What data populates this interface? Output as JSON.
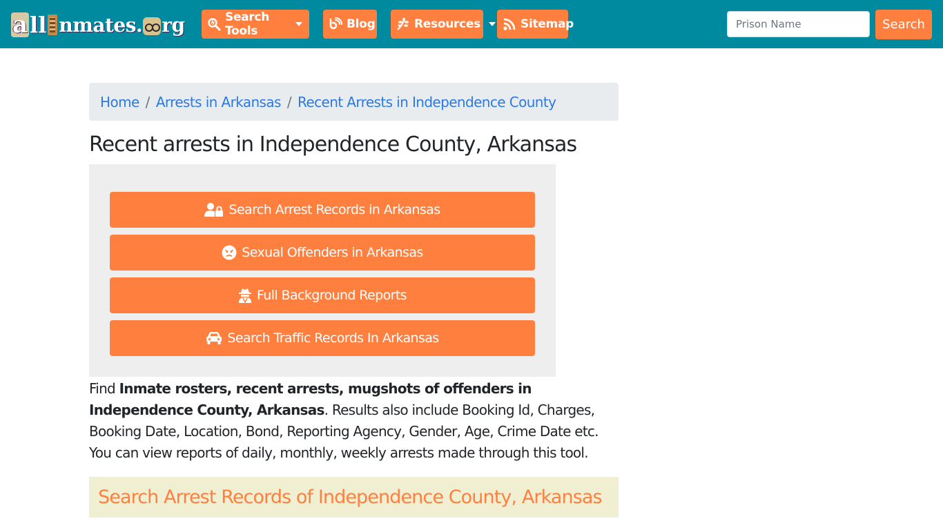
{
  "site": {
    "logo_text": "allInmates.org",
    "logo_parts": {
      "a": "a",
      "ll": "ll",
      "rest": "nmates.",
      "end": "rg"
    }
  },
  "nav": {
    "items": [
      {
        "label": "Search Tools",
        "icon": "search-icon",
        "has_dropdown": true
      },
      {
        "label": "Blog",
        "icon": "blog-icon",
        "has_dropdown": false
      },
      {
        "label": "Resources",
        "icon": "leaf-icon",
        "has_dropdown": true
      },
      {
        "label": "Sitemap",
        "icon": "rss-icon",
        "has_dropdown": false
      }
    ],
    "search": {
      "placeholder": "Prison Name",
      "value": "",
      "button_label": "Search"
    }
  },
  "breadcrumb": {
    "items": [
      {
        "label": "Home"
      },
      {
        "label": "Arrests in Arkansas"
      },
      {
        "label": "Recent Arrests in Independence County"
      }
    ],
    "separator": "/"
  },
  "page": {
    "title": "Recent arrests in Independence County, Arkansas"
  },
  "actions": [
    {
      "label": "Search Arrest Records in Arkansas",
      "icon": "user-lock-icon"
    },
    {
      "label": "Sexual Offenders in Arkansas",
      "icon": "angry-face-icon"
    },
    {
      "label": "Full Background Reports",
      "icon": "user-secret-icon"
    },
    {
      "label": "Search Traffic Records In Arkansas",
      "icon": "car-icon"
    }
  ],
  "intro": {
    "prefix": "Find ",
    "bold": "Inmate rosters, recent arrests, mugshots of offenders in Independence County, Arkansas",
    "suffix": ". Results also include Booking Id, Charges, Booking Date, Location, Bond, Reporting Agency, Gender, Age, Crime Date etc. You can view reports of daily, monthly, weekly arrests made through this tool."
  },
  "section": {
    "title": "Search Arrest Records of Independence County, Arkansas"
  },
  "colors": {
    "navbar": "#008aa0",
    "accent": "#ff7f3f",
    "link": "#2a7ae2",
    "breadcrumb_bg": "#e9ecef",
    "panel_bg": "#eeeeee",
    "section_bg": "#f0efd2"
  }
}
